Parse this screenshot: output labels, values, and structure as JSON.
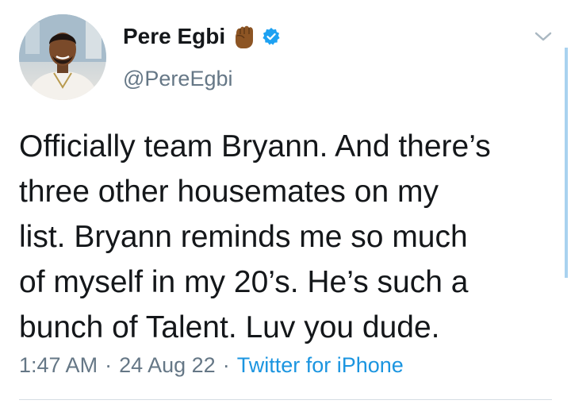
{
  "author": {
    "display_name": "Pere Egbi",
    "handle": "@PereEgbi",
    "verified": true,
    "emoji_icon": "raised-fist-icon",
    "avatar_icon": "profile-avatar"
  },
  "tweet": {
    "lines": [
      "Officially team Bryann. And there’s",
      "three other housemates on my",
      "list. Bryann reminds me so much",
      "of myself in my 20’s. He’s such a",
      "bunch of Talent.  Luv you dude."
    ]
  },
  "meta": {
    "time": "1:47 AM",
    "separator": "·",
    "date": "24 Aug 22",
    "source": "Twitter for iPhone"
  },
  "colors": {
    "link": "#1b95e0",
    "secondary_text": "#657786",
    "verified_badge": "#1da1f2",
    "fist_emoji": "#8d5524"
  },
  "icons": {
    "menu": "chevron-down-icon",
    "verified": "verified-badge-icon"
  }
}
